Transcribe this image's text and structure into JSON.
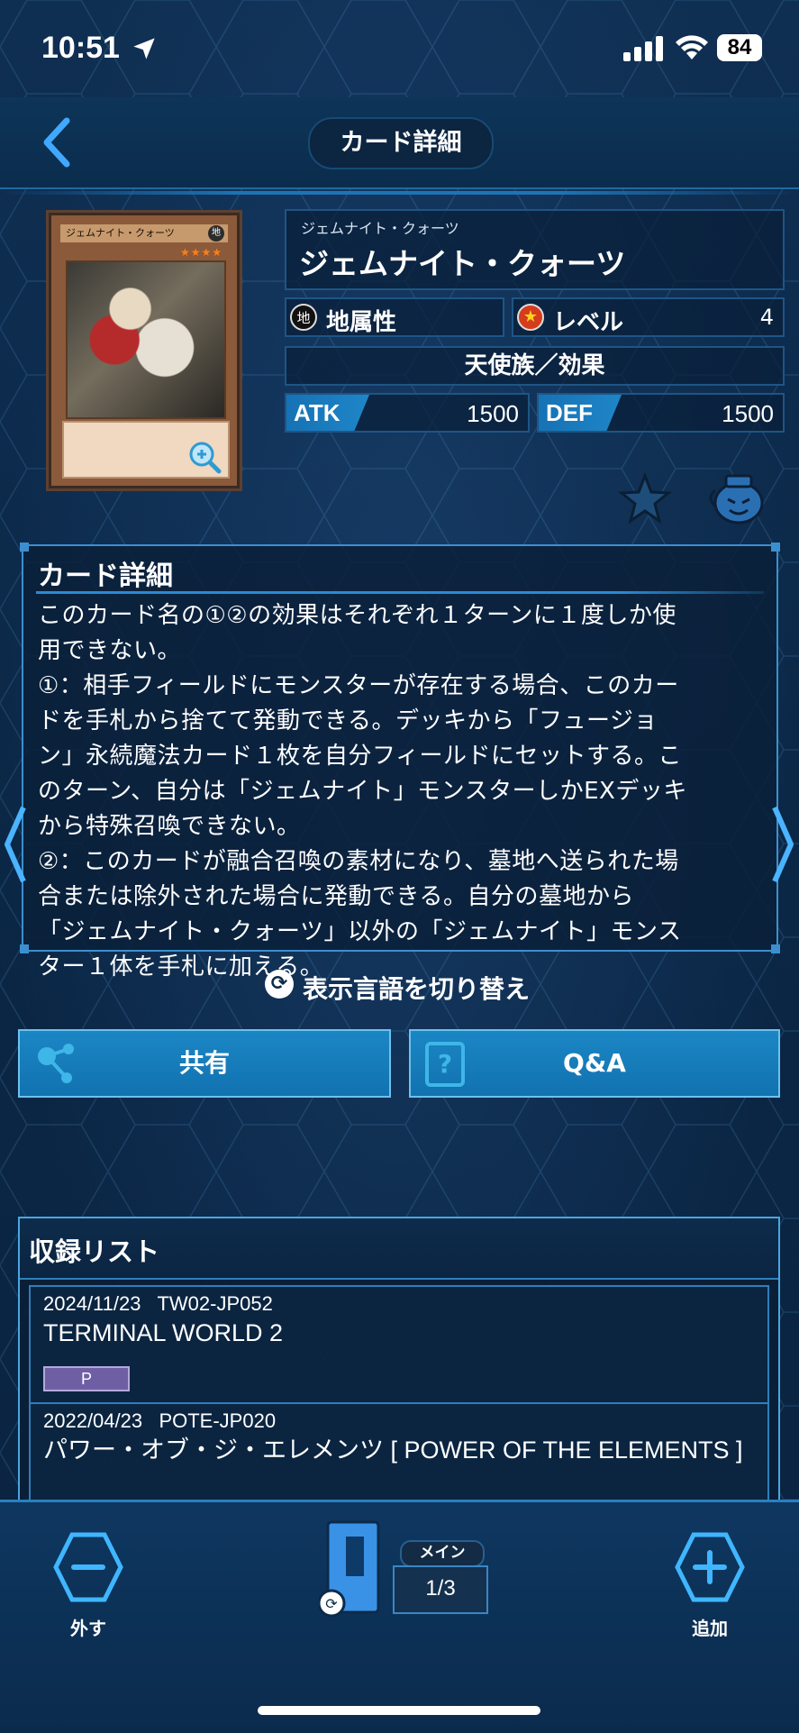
{
  "status_bar": {
    "time": "10:51",
    "battery": "84"
  },
  "header": {
    "title": "カード詳細"
  },
  "card": {
    "image_name": "ジェムナイト・クォーツ",
    "image_attr": "地",
    "image_stars": "★★★★",
    "ruby": "ジェムナイト・クォーツ",
    "name": "ジェムナイト・クォーツ",
    "attribute_icon": "地",
    "attribute": "地属性",
    "level_label": "レベル",
    "level": "4",
    "type": "天使族／効果",
    "atk_label": "ATK",
    "atk": "1500",
    "def_label": "DEF",
    "def": "1500"
  },
  "detail": {
    "heading": "カード詳細",
    "text": "このカード名の①②の効果はそれぞれ１ターンに１度しか使\n用できない。\n①：相手フィールドにモンスターが存在する場合、このカー\nドを手札から捨てて発動できる。デッキから「フュージョ\nン」永続魔法カード１枚を自分フィールドにセットする。こ\nのターン、自分は「ジェムナイト」モンスターしかEXデッキ\nから特殊召喚できない。\n②：このカードが融合召喚の素材になり、墓地へ送られた場\n合または除外された場合に発動できる。自分の墓地から\n「ジェムナイト・クォーツ」以外の「ジェムナイト」モンス\nター１体を手札に加える。"
  },
  "language_toggle": "表示言語を切り替え",
  "buttons": {
    "share": "共有",
    "qa": "Q&A"
  },
  "recording_list": {
    "heading": "収録リスト",
    "items": [
      {
        "date": "2024/11/23",
        "code": "TW02-JP052",
        "title": "TERMINAL WORLD 2",
        "rarity": "P"
      },
      {
        "date": "2022/04/23",
        "code": "POTE-JP020",
        "title": "パワー・オブ・ジ・エレメンツ [ POWER OF THE ELEMENTS ]"
      }
    ]
  },
  "bottom_bar": {
    "remove_label": "外す",
    "add_label": "追加",
    "deck_tag": "メイン",
    "deck_count": "1/3"
  }
}
